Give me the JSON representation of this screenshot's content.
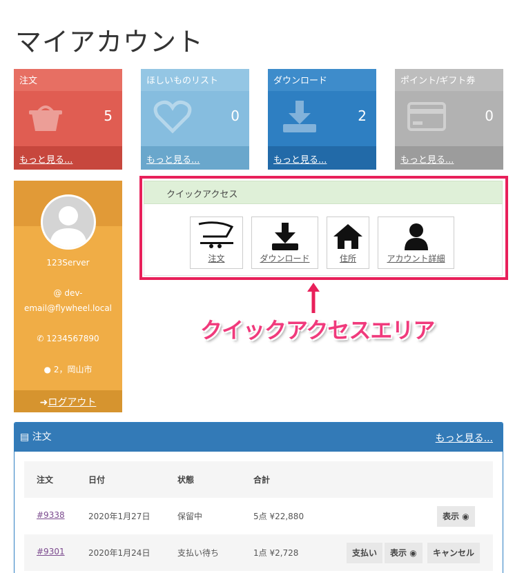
{
  "page": {
    "title": "マイアカウント"
  },
  "cards": [
    {
      "title": "注文",
      "count": "5",
      "more": "もっと見る...",
      "icon": "basket-icon"
    },
    {
      "title": "ほしいものリスト",
      "count": "0",
      "more": "もっと見る...",
      "icon": "heart-icon"
    },
    {
      "title": "ダウンロード",
      "count": "2",
      "more": "もっと見る...",
      "icon": "download-icon"
    },
    {
      "title": "ポイント/ギフト券",
      "count": "0",
      "more": "もっと見る...",
      "icon": "credit-card-icon"
    }
  ],
  "profile": {
    "username": "123Server",
    "email_line1": "@ dev-",
    "email_line2": "email@flywheel.local",
    "phone": "1234567890",
    "address": "2，岡山市",
    "logout": "ログアウト"
  },
  "quick_access": {
    "title": "クイックアクセス",
    "items": [
      {
        "label": "注文",
        "icon": "cart-icon"
      },
      {
        "label": "ダウンロード",
        "icon": "download-icon"
      },
      {
        "label": "住所",
        "icon": "home-icon"
      },
      {
        "label": "アカウント詳細",
        "icon": "user-icon"
      }
    ],
    "callout": "クイックアクセスエリア"
  },
  "orders": {
    "title": "注文",
    "more": "もっと見る...",
    "columns": [
      "注文",
      "日付",
      "状態",
      "合計"
    ],
    "rows": [
      {
        "id": "#9338",
        "date": "2020年1月27日",
        "status": "保留中",
        "total": "5点 ¥22,880",
        "actions": [
          "表示"
        ]
      },
      {
        "id": "#9301",
        "date": "2020年1月24日",
        "status": "支払い待ち",
        "total": "1点 ¥2,728",
        "actions": [
          "支払い",
          "表示",
          "キャンセル"
        ]
      }
    ]
  },
  "colors": {
    "accent_frame": "#e8205a",
    "callout": "#f03a7c",
    "panel_blue": "#337ab7"
  }
}
